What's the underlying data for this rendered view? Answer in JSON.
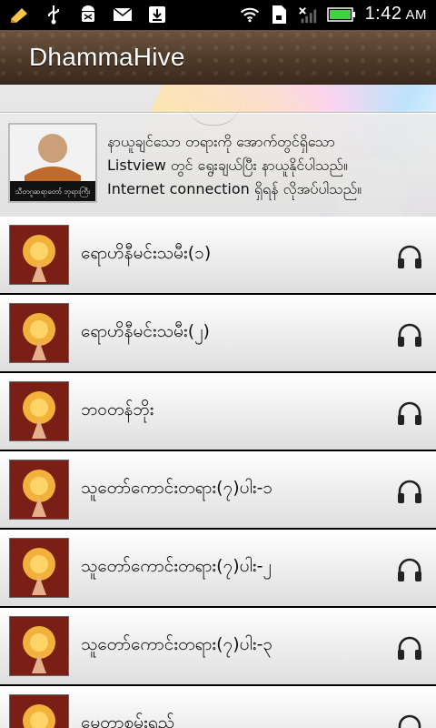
{
  "status_bar": {
    "time": "1:42",
    "ampm": "AM",
    "icons": [
      "notes-icon",
      "usb-icon",
      "android-debug-icon",
      "mail-icon",
      "download-icon",
      "wifi-icon",
      "sd-card-icon",
      "no-signal-icon",
      "battery-icon"
    ]
  },
  "app": {
    "title": "DhammaHive"
  },
  "banner": {
    "lines": [
      "နာယူချင်သော တရားကို အောက်တွင်ရှိသော",
      "Listview တွင် ရွေးချယ်ပြီး နာယူနိုင်ပါသည်။",
      "Internet connection ရှိရန် လိုအပ်ပါသည်။"
    ],
    "avatar_caption": "သီတဂူဆရာတော် ဘုရားကြီး"
  },
  "list": {
    "items": [
      {
        "label": "ရောဟိနီမင်းသမီး(၁)"
      },
      {
        "label": "ရောဟိနီမင်းသမီး(၂)"
      },
      {
        "label": "ဘဝတန်ဘိုး"
      },
      {
        "label": "သူတော်ကောင်းတရား(၇)ပါး-၁"
      },
      {
        "label": "သူတော်ကောင်းတရား(၇)ပါး-၂"
      },
      {
        "label": "သူတော်ကောင်းတရား(၇)ပါး-၃"
      },
      {
        "label": "မေတ္တာစမ်းရည်"
      }
    ]
  },
  "colors": {
    "title_bar": "#4e3928",
    "list_bg": "#e6e6e6",
    "thumb_bg": "#7a1f16"
  }
}
